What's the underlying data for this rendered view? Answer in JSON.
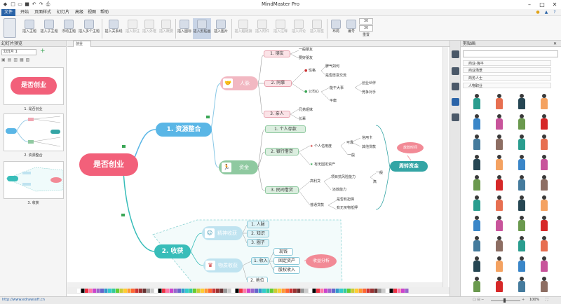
{
  "app": {
    "title": "MindMaster Pro"
  },
  "menu": {
    "items": [
      "文件",
      "开始",
      "页面样式",
      "幻灯片",
      "高级",
      "视图",
      "帮助"
    ]
  },
  "ribbon": {
    "buttons": [
      "插入主题",
      "插入子主题",
      "浮动主题",
      "插入多个主题",
      "插入关系线",
      "插入标注",
      "插入外框",
      "插入概要",
      "插入图标",
      "插入剪贴画",
      "插入图片",
      "插入超链接",
      "插入附件",
      "插入注释",
      "插入评论",
      "插入标签",
      "布局",
      "编号"
    ],
    "spin1": "30",
    "spin2": "30",
    "reset": "重置"
  },
  "slides": {
    "panel_title": "幻灯片预览",
    "selector": "幻灯片 1",
    "items": [
      "1. 是否创业",
      "2. 资源整合",
      "3. 收获"
    ],
    "thumb1": "是否创业"
  },
  "doc": {
    "tab": "创业"
  },
  "map": {
    "central": "是否创业",
    "b1": "1. 资源整合",
    "b2": "2. 收获",
    "people": "人脉",
    "money": "资金",
    "p1": "1. 朋友",
    "p2": "2. 同事",
    "p3": "3. 亲人",
    "p1a": "一般朋友",
    "p1b": "要好朋友",
    "p2a": "性格",
    "p2a1": "脾气如何",
    "p2a2": "是否愿意交流",
    "p2b": "公司心",
    "p2b1": "能干大事",
    "p2b2": "平庸",
    "p2b3": "创业伙伴",
    "p2b4": "竞争对手",
    "p3a": "兄弟姐妹",
    "p3b": "长辈",
    "m1": "1. 个人存款",
    "m2": "2. 银行借贷",
    "m3": "3. 民间借贷",
    "m2a": "个人信用度",
    "m2a1": "可靠",
    "m2a2": "一般",
    "m2a3": "信用卡",
    "m2a4": "其他贷款",
    "m2b": "有无固定资产",
    "m3a": "高利贷",
    "m3a1": "项目抗风险能力",
    "m3a2": "还款能力",
    "m3a3": "一般",
    "m3a4": "高",
    "m3b": "普通贷款",
    "m3b1": "是否有担保",
    "m3b2": "有无买物抵押",
    "callout1": "放款时间",
    "turnover": "周转资金",
    "spirit": "精神收获",
    "s1": "1. 人脉",
    "s2": "2. 知识",
    "s3": "3. 圈子",
    "material": "物质收获",
    "mt1": "1. 收入",
    "mt2": "2. 地位",
    "mt1a": "现钱",
    "mt1b": "固定资产",
    "mt1c": "股权收入",
    "callout2": "收益分析"
  },
  "clipart": {
    "panel_title": "剪贴画",
    "categories": [
      "商业-海平",
      "商业场景",
      "商务人士",
      "人物职业"
    ]
  },
  "status": {
    "website": "http://www.edrawsoft.cn",
    "zoom": "100%"
  },
  "colors": {
    "central": "#f2607a",
    "resource": "#5ab6e6",
    "gain": "#38bdb9",
    "turnover": "#34a5a5",
    "callout": "#f28a96"
  }
}
